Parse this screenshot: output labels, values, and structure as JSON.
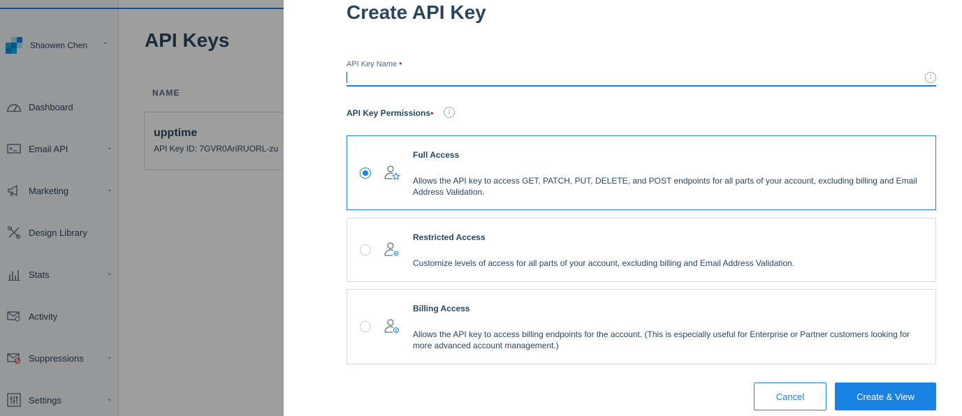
{
  "account": {
    "name": "Shaowen Chen"
  },
  "sidebar": {
    "items": [
      {
        "label": "Dashboard",
        "icon": "dashboard-icon",
        "has_submenu": false
      },
      {
        "label": "Email API",
        "icon": "email-api-icon",
        "has_submenu": true
      },
      {
        "label": "Marketing",
        "icon": "megaphone-icon",
        "has_submenu": true
      },
      {
        "label": "Design Library",
        "icon": "design-library-icon",
        "has_submenu": false
      },
      {
        "label": "Stats",
        "icon": "stats-icon",
        "has_submenu": true
      },
      {
        "label": "Activity",
        "icon": "activity-icon",
        "has_submenu": false
      },
      {
        "label": "Suppressions",
        "icon": "suppressions-icon",
        "has_submenu": true
      },
      {
        "label": "Settings",
        "icon": "settings-icon",
        "has_submenu": true
      }
    ]
  },
  "main": {
    "title": "API Keys",
    "column_header": "NAME",
    "row": {
      "name": "upptime",
      "key_id": "API Key ID: 7GVR0AriRUORL-zu"
    }
  },
  "modal": {
    "title": "Create API Key",
    "name_field": {
      "label": "API Key Name",
      "required_mark": "•",
      "value": "",
      "placeholder": ""
    },
    "permissions_label": "API Key Permissions",
    "permissions_required_mark": "•",
    "options": [
      {
        "title": "Full Access",
        "description": "Allows the API key to access GET, PATCH, PUT, DELETE, and POST endpoints for all parts of your account, excluding billing and Email Address Validation.",
        "selected": true,
        "icon": "user-star-icon"
      },
      {
        "title": "Restricted Access",
        "description": "Customize levels of access for all parts of your account, excluding billing and Email Address Validation.",
        "selected": false,
        "icon": "user-gear-icon"
      },
      {
        "title": "Billing Access",
        "description": "Allows the API key to access billing endpoints for the account. (This is especially useful for Enterprise or Partner customers looking for more advanced account management.)",
        "selected": false,
        "icon": "user-dollar-icon"
      }
    ],
    "cancel_label": "Cancel",
    "create_label": "Create & View"
  },
  "colors": {
    "accent": "#1a82e2",
    "text": "#294661",
    "required": "#c81f2a"
  }
}
